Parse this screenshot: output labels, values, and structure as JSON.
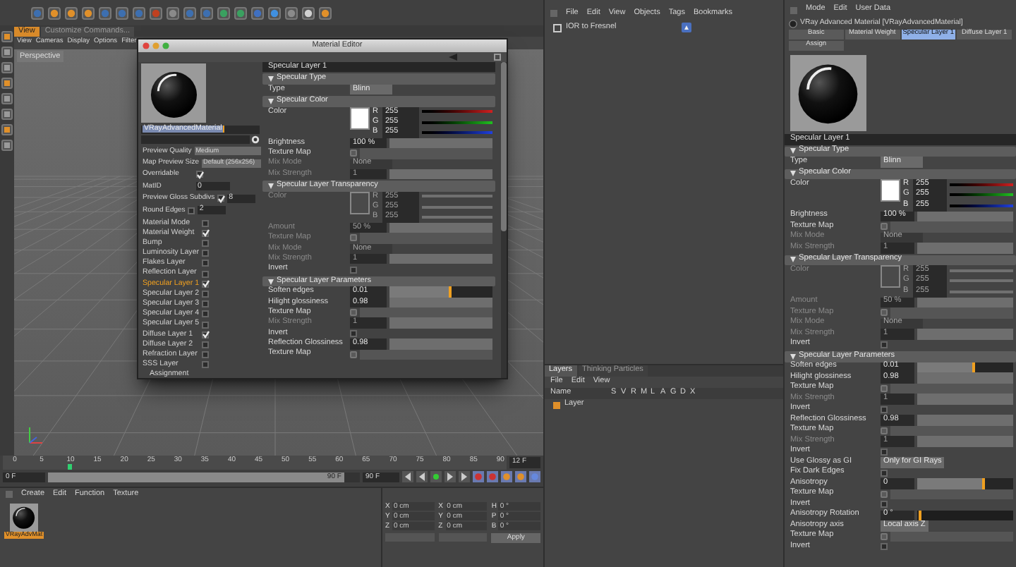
{
  "viewport": {
    "tabs": [
      {
        "label": "View",
        "selected": true
      },
      {
        "label": "Customize Commands...",
        "selected": false
      }
    ],
    "menu": [
      "View",
      "Cameras",
      "Display",
      "Options",
      "Filter"
    ],
    "camera_label": "Perspective"
  },
  "material_editor": {
    "title": "Material Editor",
    "name_value": "VRayAdvancedMaterial",
    "settings": [
      {
        "kind": "dropdown",
        "label": "Preview Quality",
        "value": "Medium"
      },
      {
        "kind": "dropdown",
        "label": "Map Preview Size",
        "value": "Default (256x256)"
      },
      {
        "kind": "checkbox",
        "label": "Overridable",
        "checked": true
      },
      {
        "kind": "number",
        "label": "MatID",
        "value": "0"
      },
      {
        "kind": "checknumber",
        "label": "Preview Gloss Subdivs",
        "checked": true,
        "value": "8"
      },
      {
        "kind": "checknumber",
        "label": "Round Edges",
        "checked": false,
        "value": "2"
      }
    ],
    "layers": [
      {
        "label": "Material Mode",
        "checked": false,
        "selected": false
      },
      {
        "label": "Material Weight",
        "checked": true,
        "selected": false
      },
      {
        "label": "Bump",
        "checked": false,
        "selected": false
      },
      {
        "label": "Luminosity Layer",
        "checked": false,
        "selected": false
      },
      {
        "label": "Flakes Layer",
        "checked": false,
        "selected": false
      },
      {
        "label": "Reflection Layer",
        "checked": false,
        "selected": false
      },
      {
        "label": "Specular Layer 1",
        "checked": true,
        "selected": true
      },
      {
        "label": "Specular Layer 2",
        "checked": false,
        "selected": false
      },
      {
        "label": "Specular Layer 3",
        "checked": false,
        "selected": false
      },
      {
        "label": "Specular Layer 4",
        "checked": false,
        "selected": false
      },
      {
        "label": "Specular Layer 5",
        "checked": false,
        "selected": false
      },
      {
        "label": "Diffuse Layer 1",
        "checked": true,
        "selected": false
      },
      {
        "label": "Diffuse Layer 2",
        "checked": false,
        "selected": false
      },
      {
        "label": "Refraction Layer",
        "checked": false,
        "selected": false
      },
      {
        "label": "SSS Layer",
        "checked": false,
        "selected": false
      }
    ],
    "assignment": "Assignment",
    "rows": [
      {
        "kind": "header",
        "label": "Specular Layer 1"
      },
      {
        "kind": "section",
        "label": "Specular Type"
      },
      {
        "kind": "dropdown",
        "label": "Type",
        "value": "Blinn",
        "disabled": false
      },
      {
        "kind": "section",
        "label": "Specular Color"
      },
      {
        "kind": "color",
        "label": "Color",
        "disabled": false,
        "channels": [
          {
            "label": "R",
            "value": "255"
          },
          {
            "label": "G",
            "value": "255"
          },
          {
            "label": "B",
            "value": "255"
          }
        ]
      },
      {
        "kind": "number",
        "label": "Brightness",
        "value": "100 %",
        "disabled": false
      },
      {
        "kind": "texture",
        "label": "Texture Map",
        "disabled": false
      },
      {
        "kind": "dropdown",
        "label": "Mix Mode",
        "value": "None",
        "disabled": true
      },
      {
        "kind": "number",
        "label": "Mix Strength",
        "value": "1",
        "disabled": true
      },
      {
        "kind": "section",
        "label": "Specular Layer Transparency"
      },
      {
        "kind": "color",
        "label": "Color",
        "disabled": true,
        "channels": [
          {
            "label": "R",
            "value": "255"
          },
          {
            "label": "G",
            "value": "255"
          },
          {
            "label": "B",
            "value": "255"
          }
        ]
      },
      {
        "kind": "number",
        "label": "Amount",
        "value": "50 %",
        "disabled": true
      },
      {
        "kind": "texture",
        "label": "Texture Map",
        "disabled": true
      },
      {
        "kind": "dropdown",
        "label": "Mix Mode",
        "value": "None",
        "disabled": true
      },
      {
        "kind": "number",
        "label": "Mix Strength",
        "value": "1",
        "disabled": true
      },
      {
        "kind": "checkbox",
        "label": "Invert",
        "checked": false,
        "disabled": false
      },
      {
        "kind": "section",
        "label": "Specular Layer Parameters"
      },
      {
        "kind": "slider",
        "label": "Soften edges",
        "value": "0.01",
        "level": 0.6,
        "disabled": false
      },
      {
        "kind": "number",
        "label": "Hilight glossiness",
        "value": "0.98",
        "disabled": false
      },
      {
        "kind": "texture",
        "label": "Texture Map",
        "disabled": false
      },
      {
        "kind": "number",
        "label": "Mix Strength",
        "value": "1",
        "disabled": true
      },
      {
        "kind": "checkbox",
        "label": "Invert",
        "checked": false,
        "disabled": false
      },
      {
        "kind": "number",
        "label": "Reflection Glossiness",
        "value": "0.98",
        "disabled": false
      },
      {
        "kind": "texture",
        "label": "Texture Map",
        "disabled": false
      }
    ]
  },
  "object_manager": {
    "menu": [
      "File",
      "Edit",
      "View",
      "Objects",
      "Tags",
      "Bookmarks"
    ],
    "objects": [
      {
        "name": "IOR to Fresnel"
      }
    ]
  },
  "layer_manager": {
    "tabs": [
      {
        "label": "Layers",
        "selected": true
      },
      {
        "label": "Thinking Particles",
        "selected": false
      }
    ],
    "menu": [
      "File",
      "Edit",
      "View"
    ],
    "columns": [
      "Name",
      "S",
      "V",
      "R",
      "M",
      "L",
      "A",
      "G",
      "D",
      "X"
    ],
    "rows": [
      {
        "name": "Layer"
      }
    ]
  },
  "attribute_manager": {
    "menu": [
      "Mode",
      "Edit",
      "User Data"
    ],
    "title": "VRay Advanced Material [VRayAdvancedMaterial]",
    "tabs": [
      {
        "label": "Basic",
        "selected": false
      },
      {
        "label": "Material Weight",
        "selected": false
      },
      {
        "label": "Specular Layer 1",
        "selected": true
      },
      {
        "label": "Diffuse Layer 1",
        "selected": false
      },
      {
        "label": "Assign",
        "selected": false
      }
    ],
    "rows": [
      {
        "kind": "header",
        "label": "Specular Layer 1"
      },
      {
        "kind": "section",
        "label": "Specular Type"
      },
      {
        "kind": "dropdown",
        "label": "Type",
        "value": "Blinn",
        "disabled": false
      },
      {
        "kind": "section",
        "label": "Specular Color"
      },
      {
        "kind": "color",
        "label": "Color",
        "disabled": false,
        "channels": [
          {
            "label": "R",
            "value": "255"
          },
          {
            "label": "G",
            "value": "255"
          },
          {
            "label": "B",
            "value": "255"
          }
        ]
      },
      {
        "kind": "number",
        "label": "Brightness",
        "value": "100 %",
        "disabled": false
      },
      {
        "kind": "texture",
        "label": "Texture Map",
        "disabled": false
      },
      {
        "kind": "dropdown",
        "label": "Mix Mode",
        "value": "None",
        "disabled": true
      },
      {
        "kind": "number",
        "label": "Mix Strength",
        "value": "1",
        "disabled": true
      },
      {
        "kind": "section",
        "label": "Specular Layer Transparency"
      },
      {
        "kind": "color",
        "label": "Color",
        "disabled": true,
        "channels": [
          {
            "label": "R",
            "value": "255"
          },
          {
            "label": "G",
            "value": "255"
          },
          {
            "label": "B",
            "value": "255"
          }
        ]
      },
      {
        "kind": "number",
        "label": "Amount",
        "value": "50 %",
        "disabled": true
      },
      {
        "kind": "texture",
        "label": "Texture Map",
        "disabled": true
      },
      {
        "kind": "dropdown",
        "label": "Mix Mode",
        "value": "None",
        "disabled": true
      },
      {
        "kind": "number",
        "label": "Mix Strength",
        "value": "1",
        "disabled": true
      },
      {
        "kind": "checkbox",
        "label": "Invert",
        "checked": false,
        "disabled": false
      },
      {
        "kind": "section",
        "label": "Specular Layer Parameters"
      },
      {
        "kind": "slider",
        "label": "Soften edges",
        "value": "0.01",
        "level": 0.6,
        "disabled": false
      },
      {
        "kind": "number",
        "label": "Hilight glossiness",
        "value": "0.98",
        "disabled": false
      },
      {
        "kind": "texture",
        "label": "Texture Map",
        "disabled": false
      },
      {
        "kind": "number",
        "label": "Mix Strength",
        "value": "1",
        "disabled": true
      },
      {
        "kind": "checkbox",
        "label": "Invert",
        "checked": false,
        "disabled": false
      },
      {
        "kind": "number",
        "label": "Reflection Glossiness",
        "value": "0.98",
        "disabled": false
      },
      {
        "kind": "texture",
        "label": "Texture Map",
        "disabled": false
      },
      {
        "kind": "number",
        "label": "Mix Strength",
        "value": "1",
        "disabled": true
      },
      {
        "kind": "checkbox",
        "label": "Invert",
        "checked": false,
        "disabled": false
      },
      {
        "kind": "dropdown",
        "label": "Use Glossy as GI",
        "value": "Only for GI Rays",
        "disabled": false
      },
      {
        "kind": "checkbox",
        "label": "Fix Dark Edges",
        "checked": false,
        "disabled": false
      },
      {
        "kind": "slider",
        "label": "Anisotropy",
        "value": "0",
        "level": 0.7,
        "disabled": false
      },
      {
        "kind": "texture",
        "label": "Texture Map",
        "disabled": false
      },
      {
        "kind": "checkbox",
        "label": "Invert",
        "checked": false,
        "disabled": false
      },
      {
        "kind": "dark_slider",
        "label": "Anisotropy Rotation",
        "value": "0 °",
        "level": 0.05,
        "disabled": false
      },
      {
        "kind": "dropdown",
        "label": "Anisotropy axis",
        "value": "Local axis Z",
        "disabled": false
      },
      {
        "kind": "texture",
        "label": "Texture Map",
        "disabled": false
      },
      {
        "kind": "checkbox",
        "label": "Invert",
        "checked": false,
        "disabled": false
      }
    ]
  },
  "timeline": {
    "ticks": [
      "0",
      "5",
      "10",
      "15",
      "20",
      "25",
      "30",
      "35",
      "40",
      "45",
      "50",
      "55",
      "60",
      "65",
      "70",
      "75",
      "80",
      "85",
      "90"
    ],
    "playhead": {
      "level": 0.13
    },
    "end_field": "12 F",
    "start_field": "0 F",
    "range": {
      "level": 0.95,
      "label": "90 F"
    },
    "max_field": "90 F"
  },
  "material_manager": {
    "menu": [
      "Create",
      "Edit",
      "Function",
      "Texture"
    ],
    "materials": [
      {
        "name": "VRayAdvMat",
        "selected": true
      }
    ]
  },
  "coordinates": {
    "rows": [
      [
        {
          "axis": "X",
          "value": "0 cm"
        },
        {
          "axis": "X",
          "value": "0 cm"
        },
        {
          "axis": "H",
          "value": "0 °"
        }
      ],
      [
        {
          "axis": "Y",
          "value": "0 cm"
        },
        {
          "axis": "Y",
          "value": "0 cm"
        },
        {
          "axis": "P",
          "value": "0 °"
        }
      ],
      [
        {
          "axis": "Z",
          "value": "0 cm"
        },
        {
          "axis": "Z",
          "value": "0 cm"
        },
        {
          "axis": "B",
          "value": "0 °"
        }
      ]
    ],
    "apply": "Apply"
  }
}
